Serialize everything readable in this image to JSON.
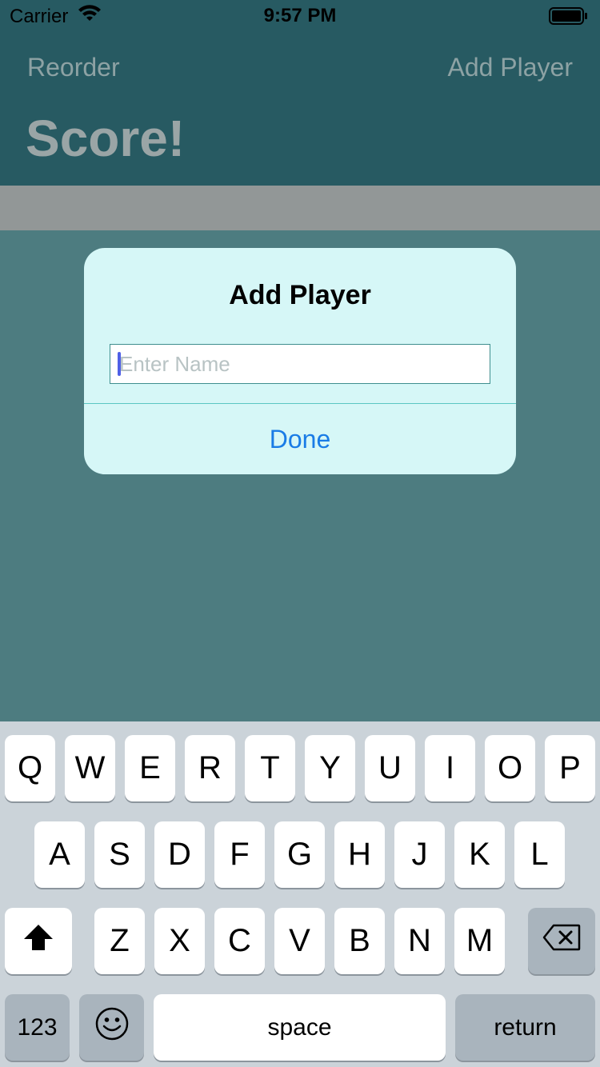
{
  "status_bar": {
    "carrier": "Carrier",
    "time": "9:57 PM",
    "wifi_icon": "wifi-icon",
    "battery_icon": "battery-icon"
  },
  "nav": {
    "left_button": "Reorder",
    "right_button": "Add Player",
    "title": "Score!"
  },
  "dialog": {
    "title": "Add Player",
    "input_placeholder": "Enter Name",
    "input_value": "",
    "done_label": "Done"
  },
  "keyboard": {
    "row1": [
      "Q",
      "W",
      "E",
      "R",
      "T",
      "Y",
      "U",
      "I",
      "O",
      "P"
    ],
    "row2": [
      "A",
      "S",
      "D",
      "F",
      "G",
      "H",
      "J",
      "K",
      "L"
    ],
    "row3": [
      "Z",
      "X",
      "C",
      "V",
      "B",
      "N",
      "M"
    ],
    "shift_icon": "shift-icon",
    "backspace_icon": "backspace-icon",
    "numbers_label": "123",
    "emoji_icon": "emoji-icon",
    "space_label": "space",
    "return_label": "return"
  }
}
